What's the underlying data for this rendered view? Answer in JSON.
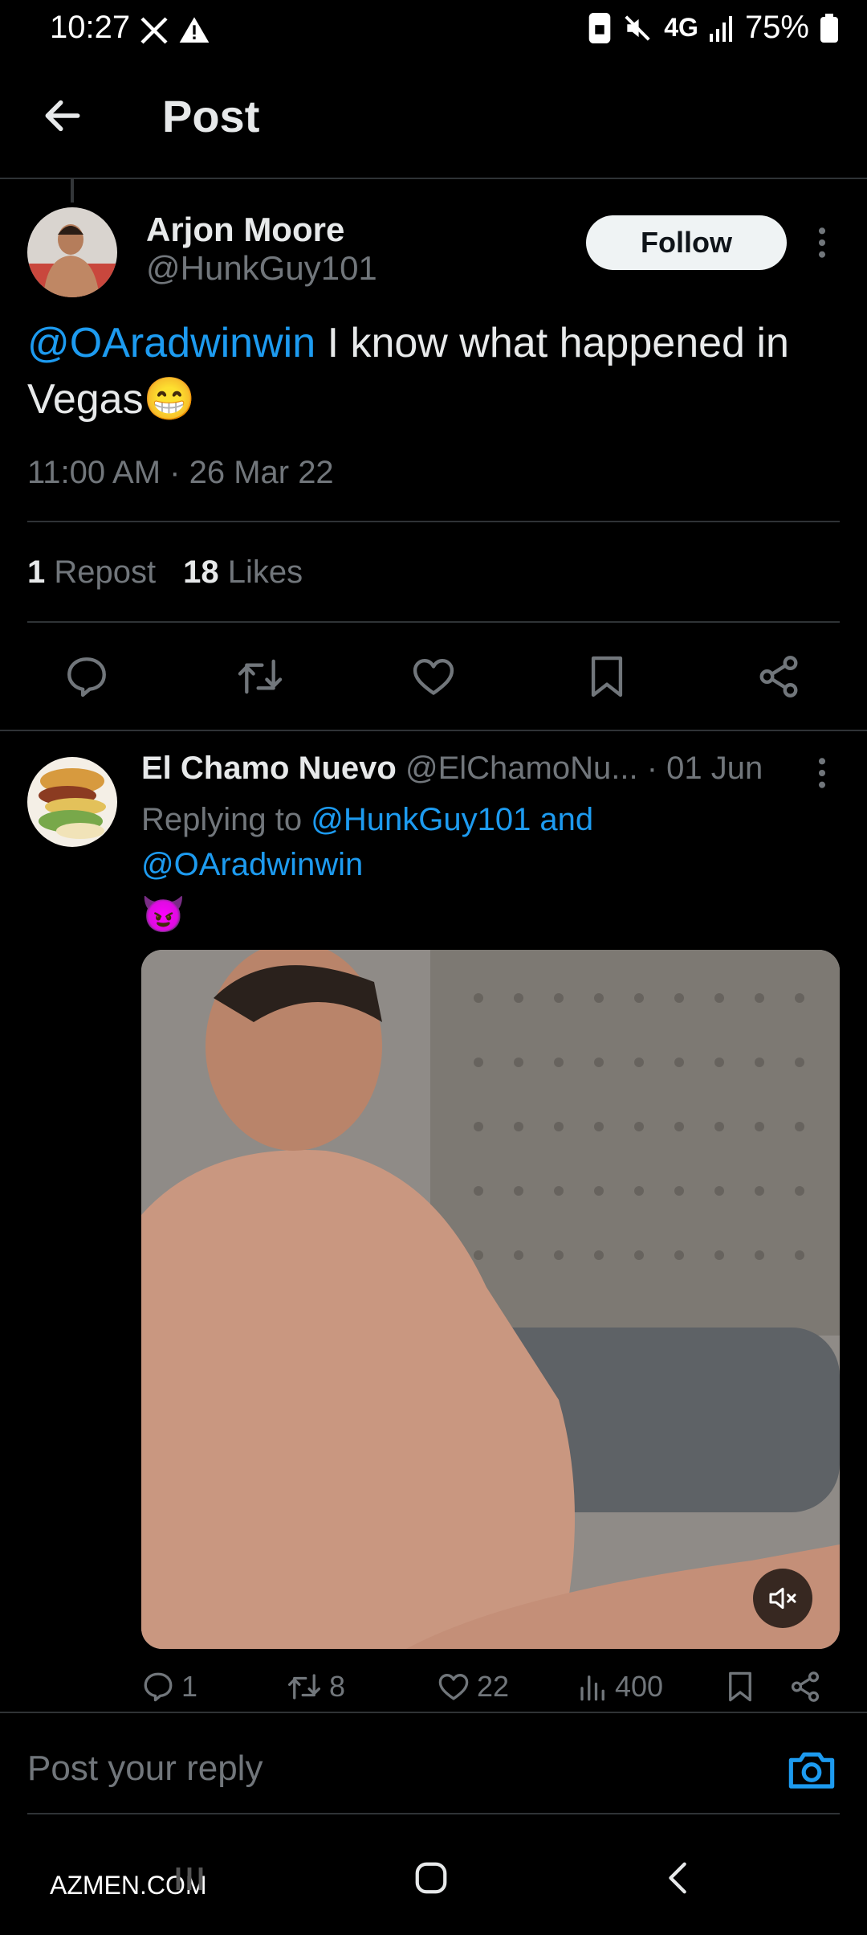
{
  "status_bar": {
    "time": "10:27",
    "network": "4G",
    "battery": "75%"
  },
  "header": {
    "title": "Post"
  },
  "post": {
    "author_name": "Arjon Moore",
    "author_handle": "@HunkGuy101",
    "follow_label": "Follow",
    "mention": "@OAradwinwin",
    "text": " I know what happened in Vegas",
    "emoji": "😁",
    "timestamp": "11:00 AM · 26 Mar 22",
    "repost_count": "1",
    "repost_label": "Repost",
    "likes_count": "18",
    "likes_label": "Likes"
  },
  "reply": {
    "author_name": "El Chamo Nuevo",
    "author_handle": "@ElChamoNu...",
    "date": "· 01 Jun",
    "replying_prefix": "Replying to ",
    "replying_to": "@HunkGuy101 and",
    "replying_to_2": "@OAradwinwin",
    "emoji": "😈",
    "comments": "1",
    "reposts": "8",
    "likes": "22",
    "views": "400"
  },
  "compose": {
    "placeholder": "Post your reply"
  },
  "watermark": "AZMEN.COM",
  "colors": {
    "background": "#000000",
    "accent": "#1d9bf0",
    "text": "#e7e9ea",
    "muted": "#71767b",
    "divider": "#2f3336"
  }
}
